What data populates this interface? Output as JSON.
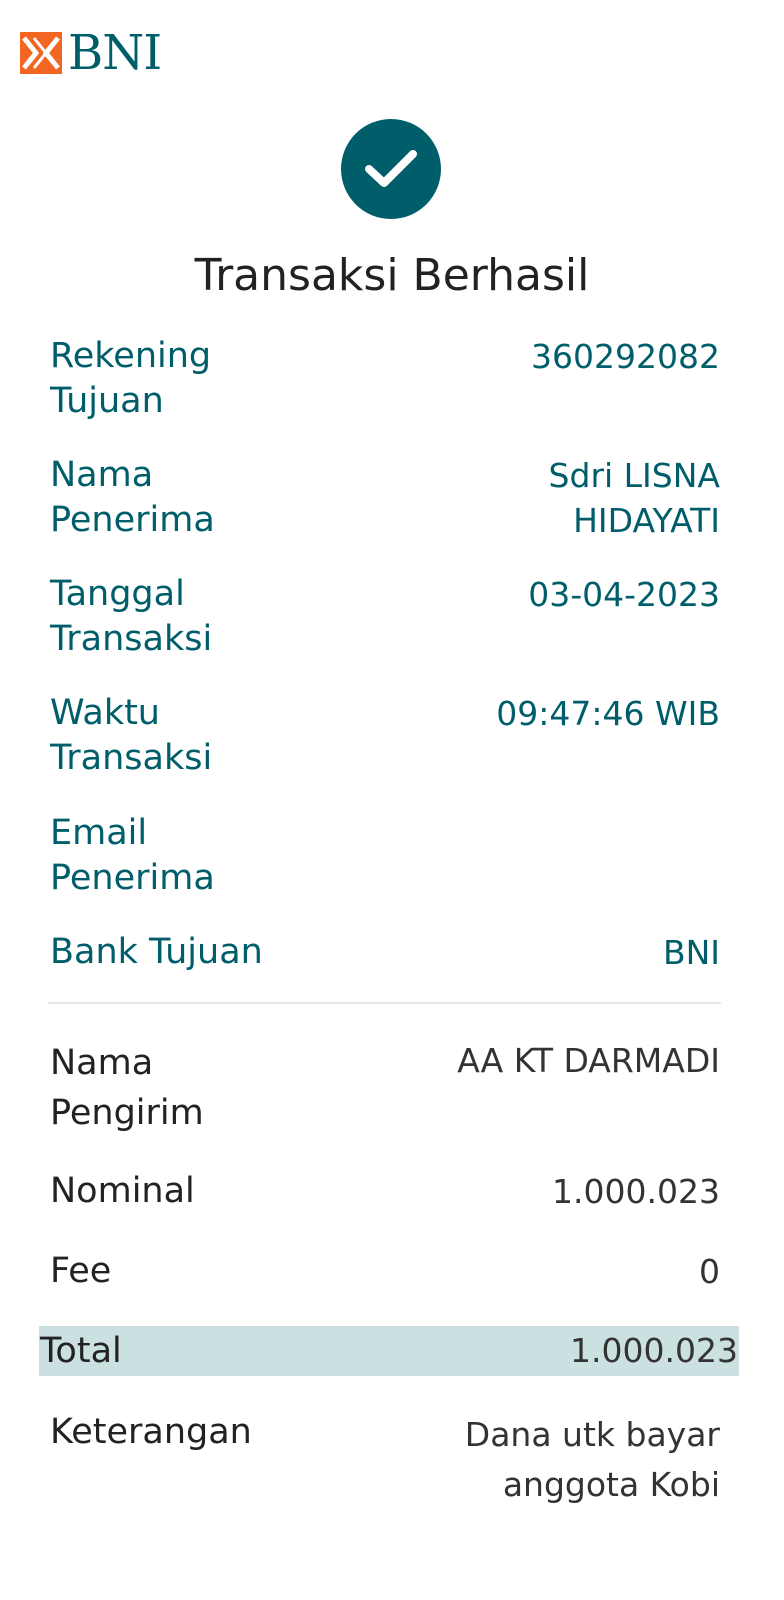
{
  "brand": {
    "name": "BNI",
    "logo_color": "#f26522",
    "text_color": "#005e6a"
  },
  "status": {
    "icon": "checkmark-icon",
    "title": "Transaksi Berhasil"
  },
  "recipient_details": [
    {
      "label": "Rekening Tujuan",
      "value": "360292082"
    },
    {
      "label": "Nama Penerima",
      "value": "Sdri LISNA HIDAYATI"
    },
    {
      "label": "Tanggal Transaksi",
      "value": "03-04-2023"
    },
    {
      "label": "Waktu Transaksi",
      "value": "09:47:46 WIB"
    },
    {
      "label": "Email Penerima",
      "value": ""
    },
    {
      "label": "Bank Tujuan",
      "value": "BNI"
    }
  ],
  "transaction_details": [
    {
      "label": "Nama Pengirim",
      "value": "AA KT DARMADI"
    },
    {
      "label": "Nominal",
      "value": "1.000.023"
    },
    {
      "label": "Fee",
      "value": "0"
    }
  ],
  "total": {
    "label": "Total",
    "value": "1.000.023"
  },
  "note": {
    "label": "Keterangan",
    "value": "Dana utk bayar anggota Kobi"
  },
  "colors": {
    "accent": "#005e6a",
    "highlight": "#cbe0e1"
  }
}
